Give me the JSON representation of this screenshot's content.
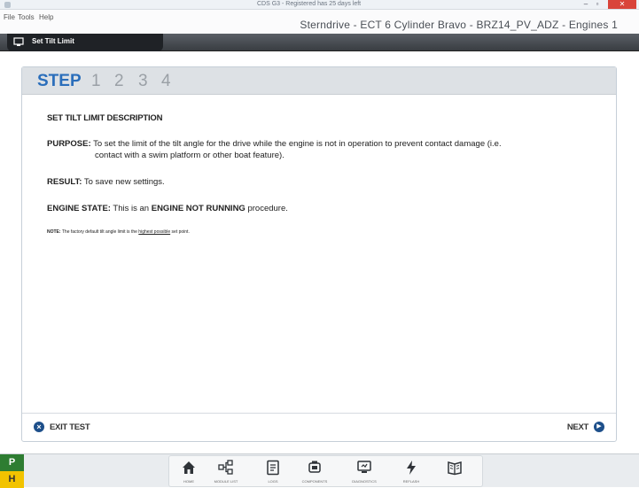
{
  "window": {
    "title": "CDS G3 - Registered has 25 days left",
    "min": "–",
    "max": "▫",
    "close": "✕"
  },
  "menu": [
    "File",
    "Tools",
    "Help"
  ],
  "engine_title": "Sterndrive - ECT 6 Cylinder Bravo - BRZ14_PV_ADZ - Engines 1",
  "tool_tab": "Set Tilt Limit",
  "steps": {
    "label": "STEP",
    "numbers": [
      "1",
      "2",
      "3",
      "4"
    ]
  },
  "content": {
    "heading": "SET TILT LIMIT DESCRIPTION",
    "purpose_label": "PURPOSE:",
    "purpose_text1": " To set the limit of the tilt angle for the drive while the engine is not in operation to prevent contact damage (i.e.",
    "purpose_text2": "contact with a swim platform or other boat feature).",
    "result_label": "RESULT:",
    "result_text": " To save new settings.",
    "state_label": "ENGINE STATE:",
    "state_text1": " This is an ",
    "state_emph": "ENGINE NOT RUNNING",
    "state_text2": " procedure.",
    "note_label": "NOTE:",
    "note_text1": " The factory default tilt angle limit is the ",
    "note_emph": "highest possible",
    "note_text2": " set point."
  },
  "footer": {
    "exit_label": "EXIT TEST",
    "next_label": "NEXT"
  },
  "indicators": [
    "P",
    "H"
  ],
  "nav": [
    {
      "label": "HOME",
      "icon": "home-icon"
    },
    {
      "label": "MODULE LIST",
      "icon": "module-list-icon"
    },
    {
      "label": "LOGS",
      "icon": "logs-icon"
    },
    {
      "label": "COMPONENTS",
      "icon": "engine-icon"
    },
    {
      "label": "DIAGNOSTICS",
      "icon": "monitor-icon"
    },
    {
      "label": "REFLASH",
      "icon": "lightning-icon"
    },
    {
      "label": "",
      "icon": "manual-book-icon"
    }
  ]
}
